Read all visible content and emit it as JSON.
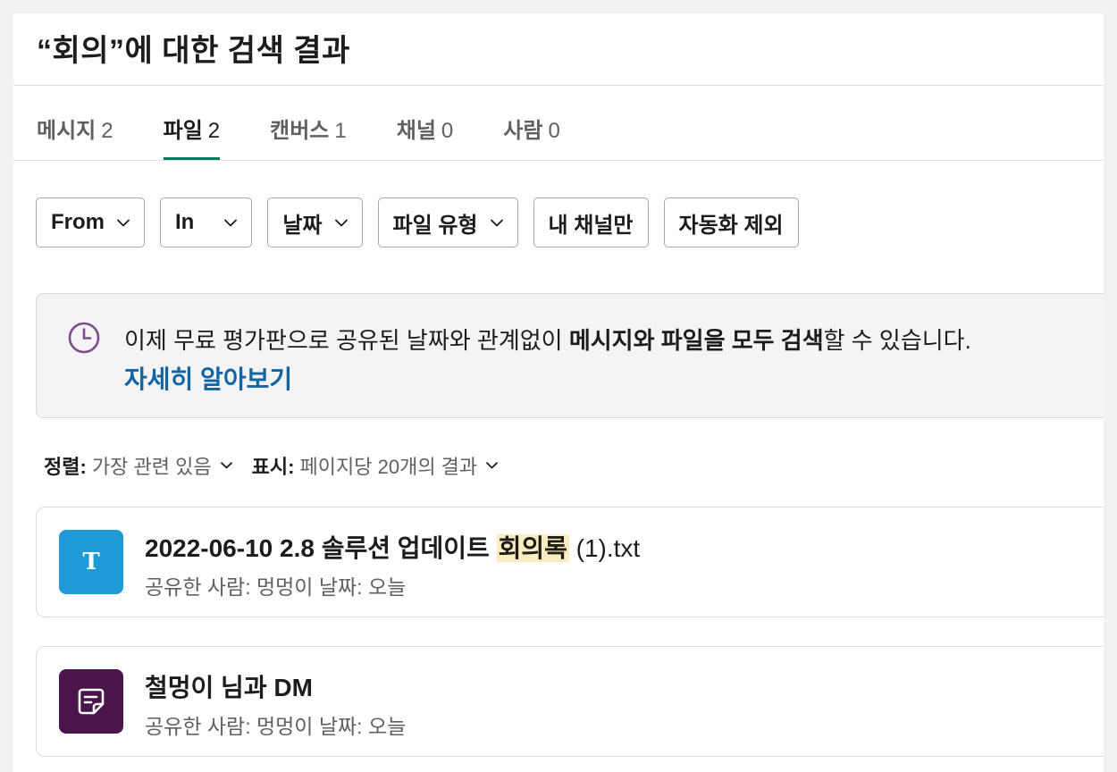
{
  "header": {
    "title": "“회의”에 대한 검색 결과"
  },
  "tabs": [
    {
      "label": "메시지",
      "count": "2",
      "active": false
    },
    {
      "label": "파일",
      "count": "2",
      "active": true
    },
    {
      "label": "캔버스",
      "count": "1",
      "active": false
    },
    {
      "label": "채널",
      "count": "0",
      "active": false
    },
    {
      "label": "사람",
      "count": "0",
      "active": false
    }
  ],
  "filters": {
    "from": "From",
    "in": "In",
    "date": "날짜",
    "file_type": "파일 유형",
    "my_channels": "내 채널만",
    "exclude_automation": "자동화 제외"
  },
  "banner": {
    "text_before": "이제 무료 평가판으로 공유된 날짜와 관계없이 ",
    "text_bold": "메시지와 파일을 모두 검색",
    "text_after": "할 수 있습니다.",
    "link": "자세히 알아보기",
    "icon": "clock-icon"
  },
  "sort": {
    "sort_label": "정렬:",
    "sort_value": "가장 관련 있음",
    "display_label": "표시:",
    "display_value": "페이지당 20개의 결과"
  },
  "results": [
    {
      "icon": "text-file-icon",
      "icon_letter": "T",
      "icon_color": "#1e9bd7",
      "name_before": "2022-06-10 2.8 솔루션 업데이트 ",
      "name_highlight": "회의록",
      "name_after": " (1).txt",
      "meta": "공유한 사람: 멍멍이 날짜: 오늘"
    },
    {
      "icon": "canvas-note-icon",
      "icon_color": "#4a154b",
      "name": "철멍이 님과 DM",
      "meta": "공유한 사람: 멍멍이 날짜: 오늘"
    }
  ],
  "colors": {
    "accent": "#007a5a",
    "link": "#1264a3",
    "highlight": "#fdecbf",
    "clock": "#7c4d8c"
  }
}
